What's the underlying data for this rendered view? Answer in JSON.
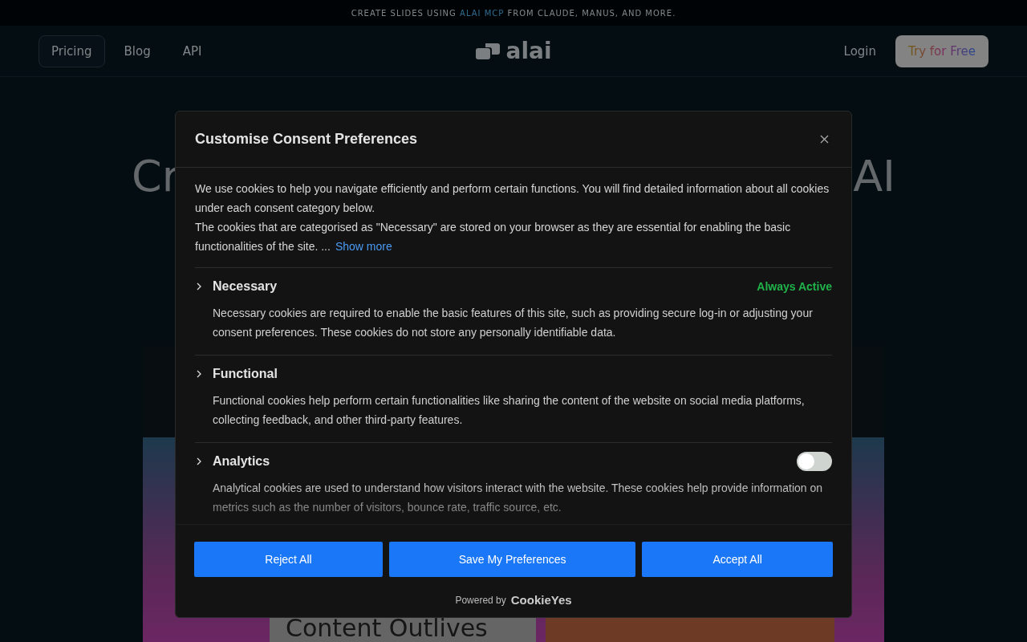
{
  "banner": {
    "before": "CREATE SLIDES USING",
    "link": "ALAI MCP",
    "after": "FROM CLAUDE, MANUS, AND MORE."
  },
  "nav": {
    "links": [
      {
        "label": "Pricing",
        "selected": true
      },
      {
        "label": "Blog",
        "selected": false
      },
      {
        "label": "API",
        "selected": false
      }
    ],
    "logo": "alai",
    "login": "Login",
    "cta": "Try for Free"
  },
  "hero": {
    "title_start": "Cr",
    "title_end": "AI"
  },
  "preview": {
    "card_title": "Content Outlives"
  },
  "consent": {
    "title": "Customise Consent Preferences",
    "intro": [
      "We use cookies to help you navigate efficiently and perform certain functions. You will find detailed information about all cookies under each consent category below.",
      "The cookies that are categorised as \"Necessary\" are stored on your browser as they are essential for enabling the basic functionalities of the site. ..."
    ],
    "show_more": "Show more",
    "categories": [
      {
        "name": "Necessary",
        "kind": "always",
        "status": "Always Active",
        "expanded": false,
        "description": "Necessary cookies are required to enable the basic features of this site, such as providing secure log-in or adjusting your consent preferences. These cookies do not store any personally identifiable data."
      },
      {
        "name": "Functional",
        "kind": "plain",
        "expanded": false,
        "description": "Functional cookies help perform certain functionalities like sharing the content of the website on social media platforms, collecting feedback, and other third-party features."
      },
      {
        "name": "Analytics",
        "kind": "toggle",
        "on": false,
        "expanded": false,
        "description": "Analytical cookies are used to understand how visitors interact with the website. These cookies help provide information on metrics such as the number of visitors, bounce rate, traffic source, etc."
      }
    ],
    "buttons": [
      "Reject All",
      "Save My Preferences",
      "Accept All"
    ],
    "powered_by": "Powered by",
    "brand": "CookieYes"
  }
}
